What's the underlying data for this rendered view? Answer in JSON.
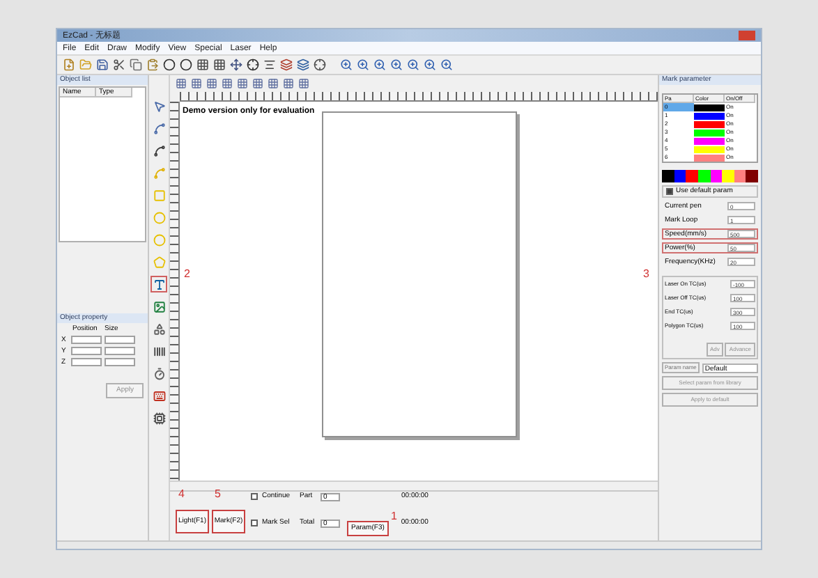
{
  "window": {
    "title": "EzCad - 无标题"
  },
  "menu": [
    "File",
    "Edit",
    "Draw",
    "Modify",
    "View",
    "Special",
    "Laser",
    "Help"
  ],
  "object_list": {
    "title": "Object list",
    "columns": [
      "Name",
      "Type"
    ]
  },
  "object_property": {
    "title": "Object property",
    "columns": [
      "Position",
      "Size"
    ],
    "rows": [
      "X",
      "Y",
      "Z"
    ],
    "apply": "Apply"
  },
  "canvas": {
    "notice": "Demo version only for evaluation",
    "callout": "2"
  },
  "tools": [
    {
      "kind": "select",
      "highlighted": false
    },
    {
      "kind": "node",
      "highlighted": false
    },
    {
      "kind": "line",
      "highlighted": false
    },
    {
      "kind": "curve",
      "highlighted": false
    },
    {
      "kind": "rect",
      "highlighted": false
    },
    {
      "kind": "circle",
      "highlighted": false
    },
    {
      "kind": "ellipse",
      "highlighted": false
    },
    {
      "kind": "polygon",
      "highlighted": false
    },
    {
      "kind": "text",
      "highlighted": true
    },
    {
      "kind": "bitmap",
      "highlighted": false
    },
    {
      "kind": "vector",
      "highlighted": false
    },
    {
      "kind": "barcode",
      "highlighted": false
    },
    {
      "kind": "timer",
      "highlighted": false
    },
    {
      "kind": "input",
      "highlighted": false
    },
    {
      "kind": "io",
      "highlighted": false
    }
  ],
  "mark_parameter": {
    "title": "Mark parameter",
    "callout": "3",
    "columns": [
      "Pa",
      "Color",
      "On/Off"
    ],
    "pens": [
      {
        "name": "0",
        "color": "#000000",
        "state": "On",
        "selected": true
      },
      {
        "name": "1",
        "color": "#0000ff",
        "state": "On",
        "selected": false
      },
      {
        "name": "2",
        "color": "#ff0000",
        "state": "On",
        "selected": false
      },
      {
        "name": "3",
        "color": "#00ff00",
        "state": "On",
        "selected": false
      },
      {
        "name": "4",
        "color": "#ff00ff",
        "state": "On",
        "selected": false
      },
      {
        "name": "5",
        "color": "#ffff00",
        "state": "On",
        "selected": false
      },
      {
        "name": "6",
        "color": "#ff8080",
        "state": "On",
        "selected": false
      }
    ],
    "palette": [
      {
        "color": "#000000"
      },
      {
        "color": "#0000ff"
      },
      {
        "color": "#ff0000"
      },
      {
        "color": "#00ff00"
      },
      {
        "color": "#ff00ff"
      },
      {
        "color": "#ffff00"
      },
      {
        "color": "#ff8080"
      },
      {
        "color": "#800000"
      }
    ],
    "use_default": {
      "label": "Use default param",
      "checked": true
    },
    "fields": [
      {
        "label": "Current pen",
        "value": "0",
        "highlighted": false
      },
      {
        "label": "Mark Loop",
        "value": "1",
        "highlighted": false
      },
      {
        "label": "Speed(mm/s)",
        "value": "500",
        "highlighted": true
      },
      {
        "label": "Power(%)",
        "value": "50",
        "highlighted": true
      },
      {
        "label": "Frequency(KHz)",
        "value": "20",
        "highlighted": false
      }
    ],
    "timing": [
      {
        "label": "Laser On TC(us)",
        "value": "-100"
      },
      {
        "label": "Laser Off TC(us)",
        "value": "100"
      },
      {
        "label": "End TC(us)",
        "value": "300"
      },
      {
        "label": "Polygon TC(us)",
        "value": "100"
      }
    ],
    "buttons": [
      "Adv",
      "Advance"
    ],
    "param_name": {
      "label": "Param name",
      "value": "Default"
    },
    "library_button": "Select param from library",
    "apply_button": "Apply to default"
  },
  "bottom": {
    "buttons": [
      {
        "label": "Light(F1)",
        "callout": "4"
      },
      {
        "label": "Mark(F2)",
        "callout": "5"
      }
    ],
    "checks": [
      {
        "label": "Continue",
        "checked": false,
        "counter": "Part",
        "value": "0",
        "time": "00:00:00"
      },
      {
        "label": "Mark Sel",
        "checked": false,
        "counter": "Total",
        "value": "0",
        "time": "00:00:00"
      }
    ],
    "param_button": {
      "label": "Param(F3)",
      "callout": "1"
    }
  }
}
